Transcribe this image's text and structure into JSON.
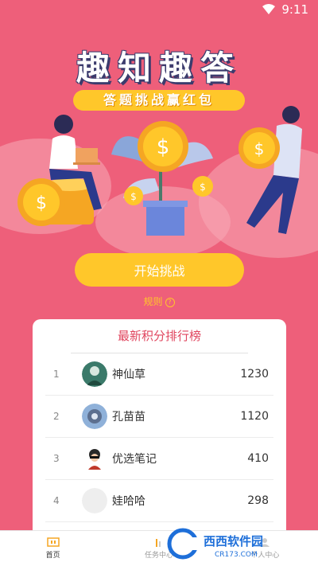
{
  "status": {
    "time": "9:11"
  },
  "hero": {
    "title": "趣知趣答",
    "subtitle": "答题挑战赢红包"
  },
  "actions": {
    "start_label": "开始挑战",
    "rules_label": "规则"
  },
  "leaderboard": {
    "title": "最新积分排行榜",
    "rows": [
      {
        "rank": "1",
        "name": "神仙草",
        "score": "1230"
      },
      {
        "rank": "2",
        "name": "孔苗苗",
        "score": "1120"
      },
      {
        "rank": "3",
        "name": "优选笔记",
        "score": "410"
      },
      {
        "rank": "4",
        "name": "娃哈哈",
        "score": "298"
      }
    ]
  },
  "tabs": [
    {
      "label": "首页"
    },
    {
      "label": "任务中心"
    },
    {
      "label": "个人中心"
    }
  ],
  "watermark": {
    "brand": "西西软件园",
    "url": "CR173.COM"
  },
  "colors": {
    "background": "#ee5f7a",
    "accent": "#ffc72a",
    "board_title": "#e0455e"
  }
}
